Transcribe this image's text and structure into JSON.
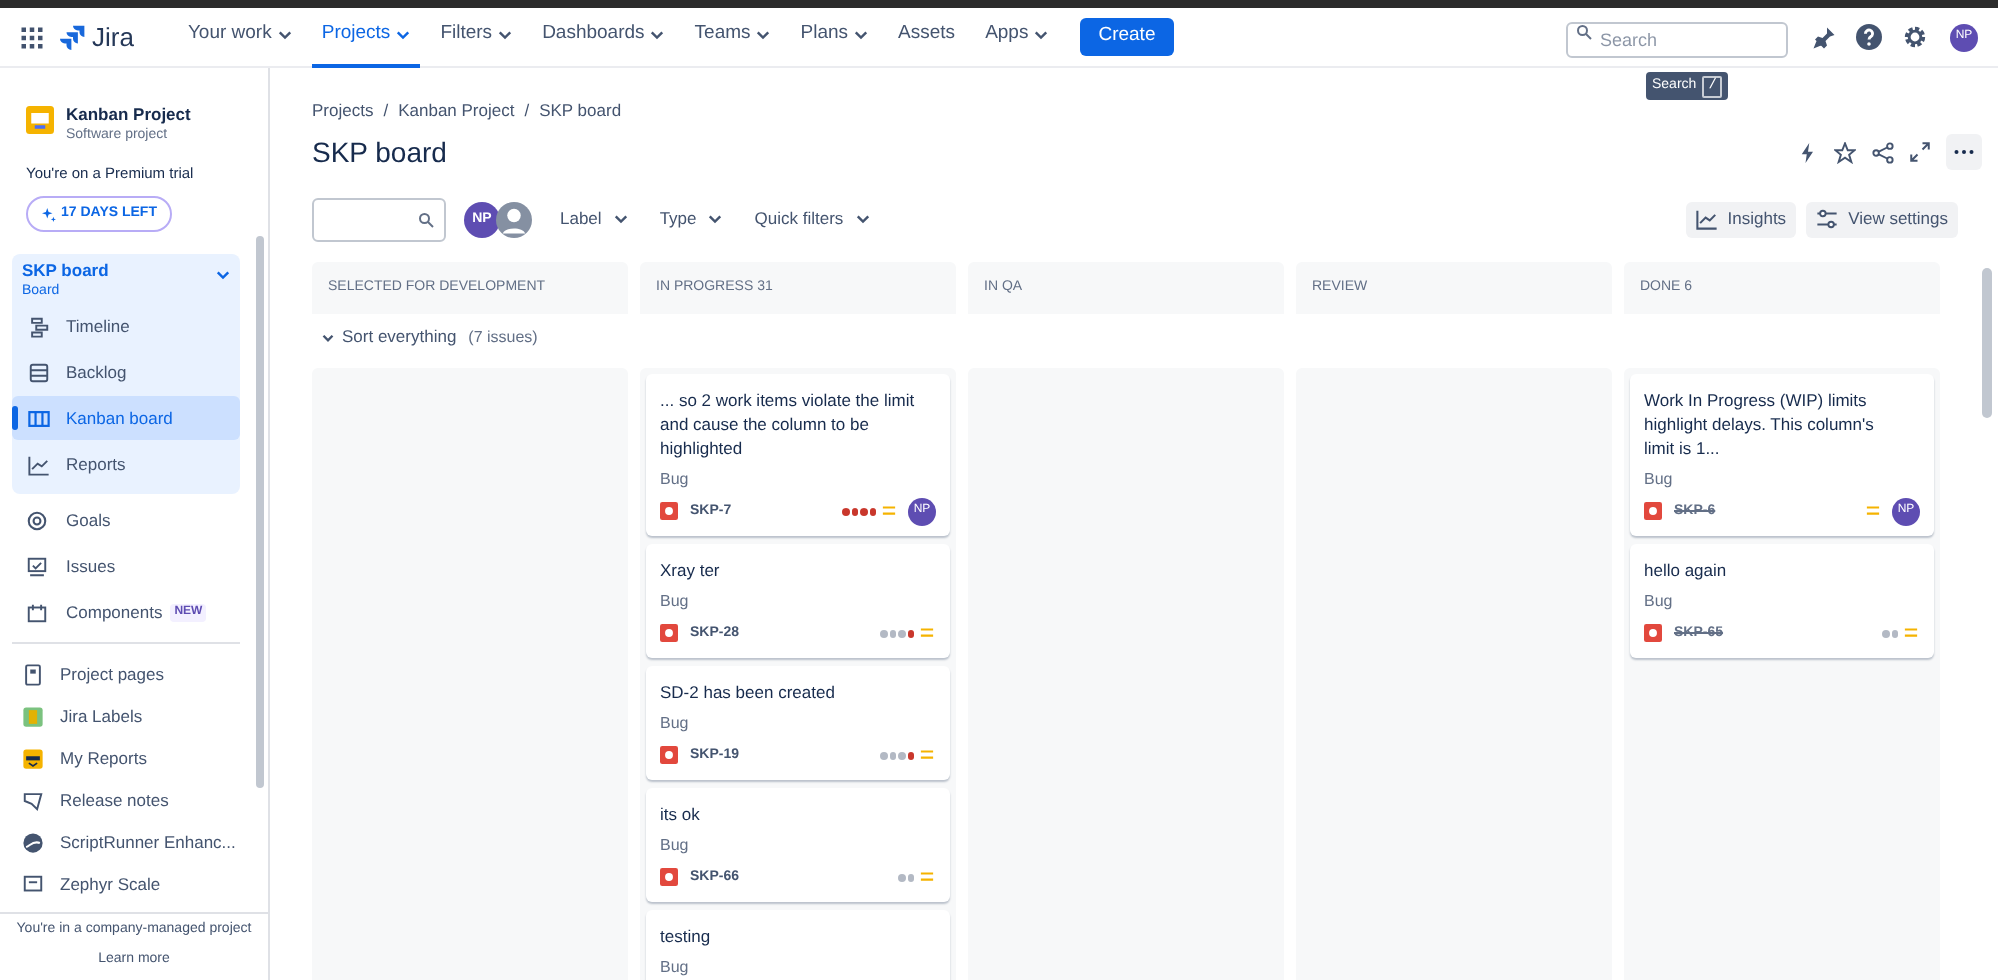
{
  "top_nav": {
    "product": "Jira",
    "items": [
      {
        "label": "Your work",
        "selected": false,
        "has_menu": true
      },
      {
        "label": "Projects",
        "selected": true,
        "has_menu": true
      },
      {
        "label": "Filters",
        "selected": false,
        "has_menu": true
      },
      {
        "label": "Dashboards",
        "selected": false,
        "has_menu": true
      },
      {
        "label": "Teams",
        "selected": false,
        "has_menu": true
      },
      {
        "label": "Plans",
        "selected": false,
        "has_menu": true
      },
      {
        "label": "Assets",
        "selected": false,
        "has_menu": false
      },
      {
        "label": "Apps",
        "selected": false,
        "has_menu": true
      }
    ],
    "create_button": "Create",
    "search": {
      "placeholder": "Search"
    },
    "tooltip": {
      "text": "Search",
      "key": "/"
    },
    "avatar": "NP"
  },
  "sidebar": {
    "project": {
      "name": "Kanban Project",
      "type": "Software project"
    },
    "trial": "You're on a Premium trial",
    "trial_button": "17 DAYS LEFT",
    "board_group": {
      "title": "SKP board",
      "subtitle": "Board",
      "expanded": true,
      "items": [
        {
          "label": "Timeline",
          "selected": false
        },
        {
          "label": "Backlog",
          "selected": false
        },
        {
          "label": "Kanban board",
          "selected": true
        },
        {
          "label": "Reports",
          "selected": false
        }
      ]
    },
    "items": [
      {
        "label": "Goals"
      },
      {
        "label": "Issues"
      },
      {
        "label": "Components",
        "badge": "NEW"
      }
    ],
    "apps": [
      {
        "label": "Project pages"
      },
      {
        "label": "Jira Labels"
      },
      {
        "label": "My Reports"
      },
      {
        "label": "Release notes"
      },
      {
        "label": "ScriptRunner Enhanc..."
      },
      {
        "label": "Zephyr Scale"
      }
    ],
    "footer": {
      "text": "You're in a company-managed project",
      "link": "Learn more"
    }
  },
  "breadcrumbs": [
    "Projects",
    "/",
    "Kanban Project",
    "/",
    "SKP board"
  ],
  "title": "SKP board",
  "toolbar": {
    "avatars": [
      "NP"
    ],
    "filters": [
      "Label",
      "Type",
      "Quick filters"
    ],
    "buttons": [
      "Insights",
      "View settings"
    ]
  },
  "board": {
    "columns": [
      {
        "title": "SELECTED FOR DEVELOPMENT"
      },
      {
        "title": "IN PROGRESS 31",
        "cards": [
          {
            "summary": "... so 2 work items violate the limit and cause the column to be highlighted",
            "type": "Bug",
            "key": "SKP-7",
            "done": false,
            "assignee": "NP",
            "dots": [
              {
                "color": "#c9372c"
              },
              {
                "color": "#c9372c"
              },
              {
                "color": "#c9372c"
              },
              {
                "color": "#c9372c"
              }
            ]
          },
          {
            "summary": "Xray ter",
            "type": "Bug",
            "key": "SKP-28",
            "done": false,
            "dots": [
              {
                "color": "#b3b9c4"
              },
              {
                "color": "#b3b9c4"
              },
              {
                "color": "#b3b9c4"
              },
              {
                "color": "#c9372c"
              }
            ]
          },
          {
            "summary": "SD-2 has been created",
            "type": "Bug",
            "key": "SKP-19",
            "done": false,
            "dots": [
              {
                "color": "#b3b9c4"
              },
              {
                "color": "#b3b9c4"
              },
              {
                "color": "#b3b9c4"
              },
              {
                "color": "#c9372c"
              }
            ]
          },
          {
            "summary": "its ok",
            "type": "Bug",
            "key": "SKP-66",
            "done": false,
            "dots": [
              {
                "color": "#b3b9c4"
              },
              {
                "color": "#b3b9c4"
              }
            ]
          },
          {
            "summary": "testing",
            "type": "Bug"
          }
        ]
      },
      {
        "title": "IN QA"
      },
      {
        "title": "REVIEW"
      },
      {
        "title": "DONE 6",
        "cards": [
          {
            "summary": "Work In Progress (WIP) limits highlight delays. This column's limit is 1...",
            "type": "Bug",
            "key": "SKP-6",
            "done": true,
            "assignee": "NP"
          },
          {
            "summary": "hello again",
            "type": "Bug",
            "key": "SKP-65",
            "done": true,
            "dots": [
              {
                "color": "#b3b9c4"
              },
              {
                "color": "#b3b9c4"
              }
            ]
          }
        ]
      }
    ],
    "swimlane": {
      "title": "Sort everything",
      "count": "(7 issues)",
      "expanded": true
    }
  }
}
